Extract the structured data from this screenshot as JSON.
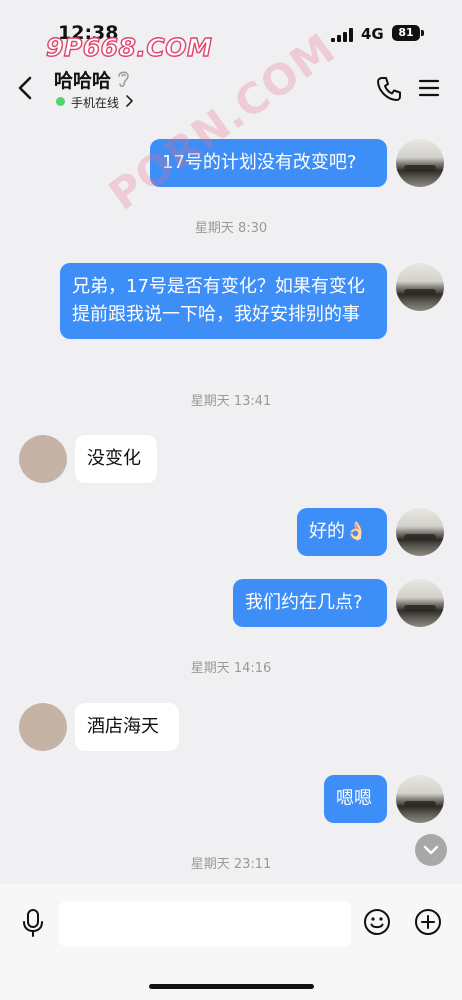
{
  "status_bar": {
    "time": "12:38",
    "network": "4G",
    "battery": "81"
  },
  "watermark": {
    "text": "9P668.COM",
    "diagonal_text": "PORN.COM"
  },
  "header": {
    "contact_name": "哈哈哈",
    "online_status": "手机在线"
  },
  "messages": [
    {
      "side": "out",
      "text": "17号的计划没有改变吧?"
    },
    {
      "type": "time",
      "text": "星期天 8:30"
    },
    {
      "side": "out",
      "text": "兄弟，17号是否有变化？如果有变化提前跟我说一下哈，我好安排别的事"
    },
    {
      "type": "time",
      "text": "星期天 13:41"
    },
    {
      "side": "in",
      "text": "没变化"
    },
    {
      "side": "out",
      "text": "好的👌🏻"
    },
    {
      "side": "out",
      "text": "我们约在几点?"
    },
    {
      "type": "time",
      "text": "星期天 14:16"
    },
    {
      "side": "in",
      "text": "酒店海天"
    },
    {
      "side": "out",
      "text": "嗯嗯"
    },
    {
      "type": "time",
      "text": "星期天 23:11"
    }
  ],
  "input": {
    "value": "",
    "placeholder": ""
  },
  "colors": {
    "outgoing_bubble": "#3d8ef6",
    "incoming_bubble": "#ffffff",
    "background": "#f0f0f2",
    "online_dot": "#53d46b"
  },
  "icons": [
    "back-icon",
    "ear-icon",
    "phone-icon",
    "menu-icon",
    "mic-icon",
    "emoji-icon",
    "plus-icon",
    "chevron-down-icon"
  ]
}
